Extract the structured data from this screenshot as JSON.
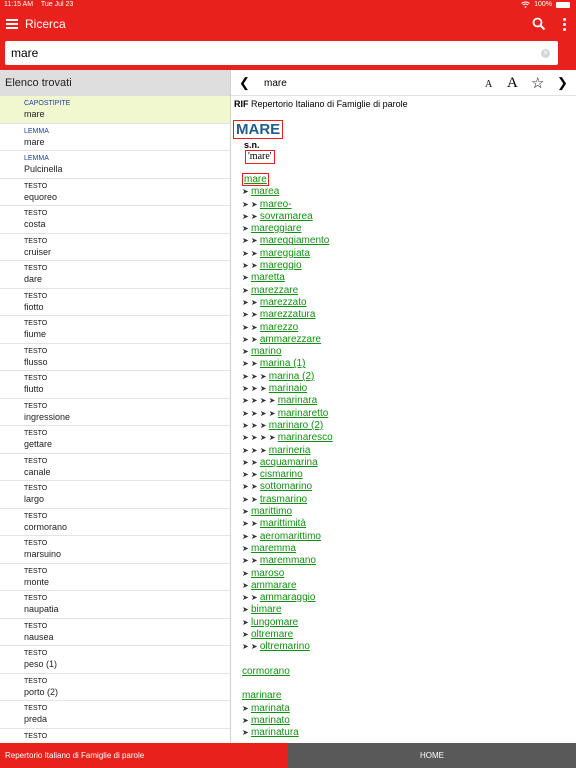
{
  "status_bar": {
    "time": "11:15 AM",
    "date": "Tue Jul 23",
    "battery": "100%"
  },
  "app_bar": {
    "title": "Ricerca"
  },
  "search": {
    "value": "mare"
  },
  "results": {
    "header": "Elenco trovati",
    "items": [
      {
        "type": "CAPOSTIPITE",
        "word": "mare"
      },
      {
        "type": "LEMMA",
        "word": "mare"
      },
      {
        "type": "LEMMA",
        "word": "Pulcinella"
      },
      {
        "type": "TESTO",
        "word": "equoreo"
      },
      {
        "type": "TESTO",
        "word": "costa"
      },
      {
        "type": "TESTO",
        "word": "cruiser"
      },
      {
        "type": "TESTO",
        "word": "dare"
      },
      {
        "type": "TESTO",
        "word": "fiotto"
      },
      {
        "type": "TESTO",
        "word": "fiume"
      },
      {
        "type": "TESTO",
        "word": "flusso"
      },
      {
        "type": "TESTO",
        "word": "flutto"
      },
      {
        "type": "TESTO",
        "word": "ingressione"
      },
      {
        "type": "TESTO",
        "word": "gettare"
      },
      {
        "type": "TESTO",
        "word": "canale"
      },
      {
        "type": "TESTO",
        "word": "largo"
      },
      {
        "type": "TESTO",
        "word": "cormorano"
      },
      {
        "type": "TESTO",
        "word": "marsuino"
      },
      {
        "type": "TESTO",
        "word": "monte"
      },
      {
        "type": "TESTO",
        "word": "naupatia"
      },
      {
        "type": "TESTO",
        "word": "nausea"
      },
      {
        "type": "TESTO",
        "word": "peso (1)"
      },
      {
        "type": "TESTO",
        "word": "porto (2)"
      },
      {
        "type": "TESTO",
        "word": "preda"
      },
      {
        "type": "TESTO",
        "word": ""
      }
    ]
  },
  "detail": {
    "nav_word": "mare",
    "font_small": "A",
    "font_big": "A",
    "source_abbr": "RIF",
    "source_name": "Repertorio Italiano di Famiglie di parole",
    "headword": "MARE",
    "grammar": "s.n.",
    "phonetic": "'mare'",
    "family": [
      {
        "word": "mare",
        "depth": 0
      },
      {
        "word": "marea",
        "depth": 1
      },
      {
        "word": "mareo-",
        "depth": 2
      },
      {
        "word": "sovramarea",
        "depth": 2
      },
      {
        "word": "mareggiare",
        "depth": 1
      },
      {
        "word": "mareggiamento",
        "depth": 2
      },
      {
        "word": "mareggiata",
        "depth": 2
      },
      {
        "word": "mareggio",
        "depth": 2
      },
      {
        "word": "maretta",
        "depth": 1
      },
      {
        "word": "marezzare",
        "depth": 1
      },
      {
        "word": "marezzato",
        "depth": 2
      },
      {
        "word": "marezzatura",
        "depth": 2
      },
      {
        "word": "marezzo",
        "depth": 2
      },
      {
        "word": "ammarezzare",
        "depth": 2
      },
      {
        "word": "marino",
        "depth": 1
      },
      {
        "word": "marina (1)",
        "depth": 2
      },
      {
        "word": "marina (2)",
        "depth": 3
      },
      {
        "word": "marinaio",
        "depth": 3
      },
      {
        "word": "marinara",
        "depth": 4
      },
      {
        "word": "marinaretto",
        "depth": 4
      },
      {
        "word": "marinaro (2)",
        "depth": 3
      },
      {
        "word": "marinaresco",
        "depth": 4
      },
      {
        "word": "marineria",
        "depth": 3
      },
      {
        "word": "acquamarina",
        "depth": 2
      },
      {
        "word": "cismarino",
        "depth": 2
      },
      {
        "word": "sottomarino",
        "depth": 2
      },
      {
        "word": "trasmarino",
        "depth": 2
      },
      {
        "word": "marittimo",
        "depth": 1
      },
      {
        "word": "marittimità",
        "depth": 2
      },
      {
        "word": "aeromarittimo",
        "depth": 2
      },
      {
        "word": "maremma",
        "depth": 1
      },
      {
        "word": "maremmano",
        "depth": 2
      },
      {
        "word": "maroso",
        "depth": 1
      },
      {
        "word": "ammarare",
        "depth": 1
      },
      {
        "word": "ammaraggio",
        "depth": 2
      },
      {
        "word": "bimare",
        "depth": 1
      },
      {
        "word": "lungomare",
        "depth": 1
      },
      {
        "word": "oltremare",
        "depth": 1
      },
      {
        "word": "oltremarino",
        "depth": 2
      }
    ],
    "related_1": [
      {
        "word": "cormorano",
        "depth": 0
      }
    ],
    "related_2": [
      {
        "word": "marinare",
        "depth": 0
      },
      {
        "word": "marinata",
        "depth": 1
      },
      {
        "word": "marinato",
        "depth": 1
      },
      {
        "word": "marinatura",
        "depth": 1
      }
    ]
  },
  "bottom_bar": {
    "left": "Repertorio Italiano di Famiglie di parole",
    "right": "HOME"
  },
  "colors": {
    "accent": "#e8211d",
    "link": "#119111",
    "headword": "#1f5d8c",
    "selected": "#f1f8cf"
  }
}
